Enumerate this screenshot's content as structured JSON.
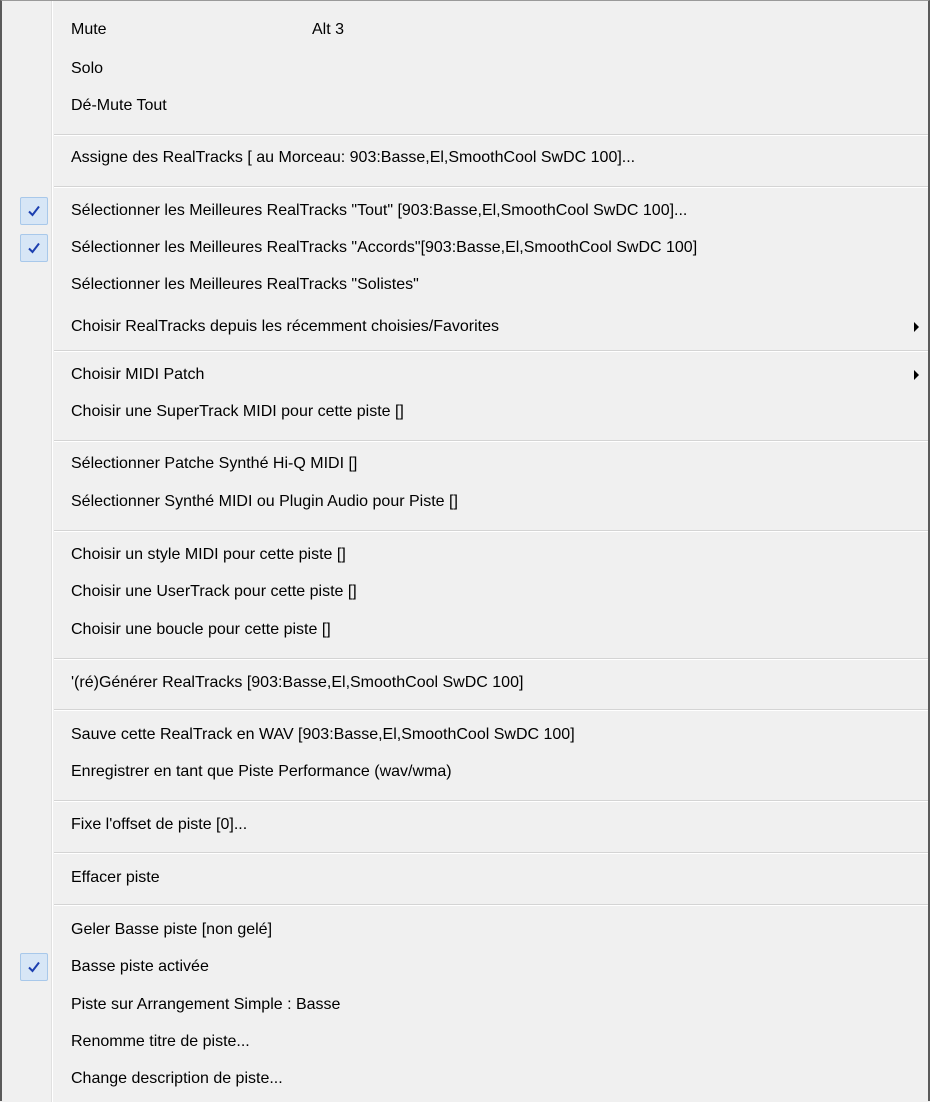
{
  "menu": {
    "items": [
      {
        "label": "Mute",
        "shortcut": "Alt 3",
        "checked": false,
        "submenu": false
      },
      {
        "label": "Solo",
        "checked": false,
        "submenu": false
      },
      {
        "label": "Dé-Mute Tout",
        "checked": false,
        "submenu": false
      },
      {
        "label": "Assigne des RealTracks [ au Morceau: 903:Basse,El,SmoothCool SwDC 100]...",
        "checked": false,
        "submenu": false
      },
      {
        "label": "Sélectionner les Meilleures RealTracks \"Tout\" [903:Basse,El,SmoothCool SwDC 100]...",
        "checked": true,
        "submenu": false
      },
      {
        "label": "Sélectionner les Meilleures RealTracks \"Accords\"[903:Basse,El,SmoothCool SwDC 100]",
        "checked": true,
        "submenu": false
      },
      {
        "label": "Sélectionner les Meilleures RealTracks \"Solistes\"",
        "checked": false,
        "submenu": false
      },
      {
        "label": "Choisir RealTracks depuis les récemment choisies/Favorites",
        "checked": false,
        "submenu": true
      },
      {
        "label": "Choisir MIDI Patch",
        "checked": false,
        "submenu": true
      },
      {
        "label": "Choisir une SuperTrack MIDI pour cette piste  []",
        "checked": false,
        "submenu": false
      },
      {
        "label": "Sélectionner Patche Synthé Hi-Q MIDI []",
        "checked": false,
        "submenu": false
      },
      {
        "label": "Sélectionner Synthé MIDI  ou Plugin Audio pour Piste []",
        "checked": false,
        "submenu": false
      },
      {
        "label": "Choisir un style MIDI pour cette piste  []",
        "checked": false,
        "submenu": false
      },
      {
        "label": "Choisir une UserTrack pour cette piste  []",
        "checked": false,
        "submenu": false
      },
      {
        "label": "Choisir une boucle pour cette piste  []",
        "checked": false,
        "submenu": false
      },
      {
        "label": "'(ré)Générer RealTracks [903:Basse,El,SmoothCool SwDC 100]",
        "checked": false,
        "submenu": false
      },
      {
        "label": "Sauve cette RealTrack en WAV [903:Basse,El,SmoothCool SwDC 100]",
        "checked": false,
        "submenu": false
      },
      {
        "label": "Enregistrer en tant que Piste Performance (wav/wma)",
        "checked": false,
        "submenu": false
      },
      {
        "label": "Fixe l'offset de piste [0]...",
        "checked": false,
        "submenu": false
      },
      {
        "label": "Effacer piste",
        "checked": false,
        "submenu": false
      },
      {
        "label": "Geler Basse piste    [non gelé]",
        "checked": false,
        "submenu": false
      },
      {
        "label": "Basse piste activée",
        "checked": true,
        "submenu": false
      },
      {
        "label": "Piste sur Arrangement Simple : Basse",
        "checked": false,
        "submenu": false
      },
      {
        "label": "Renomme titre de piste...",
        "checked": false,
        "submenu": false
      },
      {
        "label": "Change description de piste...",
        "checked": false,
        "submenu": false
      }
    ],
    "checkmark_glyph": "checkmark-icon",
    "submenu_glyph": "submenu-arrow-icon",
    "check_color": "#1c3fb0",
    "check_bg": "#d7e6f6"
  }
}
